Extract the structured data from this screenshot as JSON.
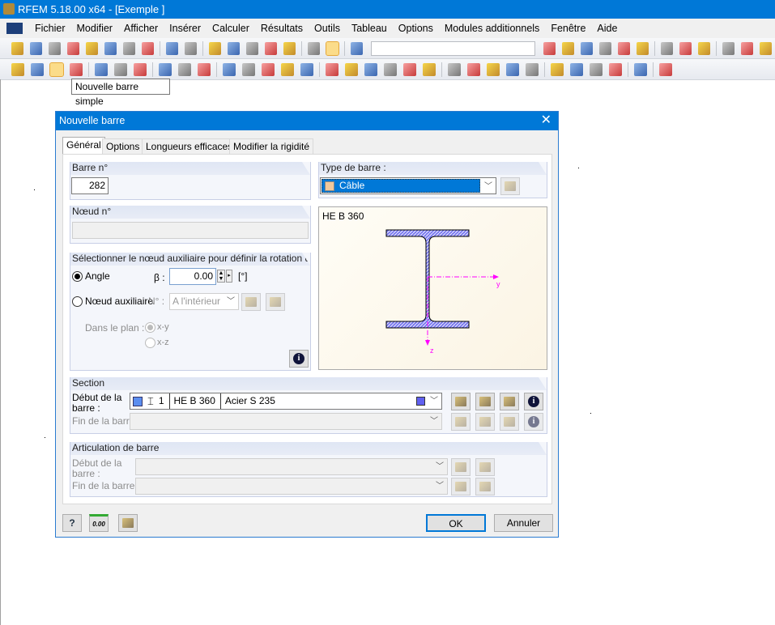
{
  "app": {
    "title": "RFEM 5.18.00 x64 - [Exemple ]"
  },
  "menu": [
    "Fichier",
    "Modifier",
    "Afficher",
    "Insérer",
    "Calculer",
    "Résultats",
    "Outils",
    "Tableau",
    "Options",
    "Modules additionnels",
    "Fenêtre",
    "Aide"
  ],
  "toolbar1": [
    "new-file-icon",
    "open-folder-icon",
    "archive-icon",
    "database-icon",
    "save-icon",
    "clipboard-icon",
    "print-icon",
    "print-preview-icon",
    "|",
    "undo-icon",
    "redo-icon",
    "|",
    "plane-icon",
    "lasso-icon",
    "target-icon",
    "select-add-icon",
    "window-icon",
    "|",
    "list-icon",
    "table-icon",
    "|",
    "node-load-icon",
    "COMBO",
    "prev-icon",
    "next-icon",
    "result-icon",
    "xxx-icon",
    "render-icon",
    "xxx2-icon",
    "|",
    "cursor-icon",
    "frame-icon",
    "grid-icon",
    "|",
    "grid2-icon",
    "zoom-icon",
    "pan-icon"
  ],
  "toolbar2": [
    "new-node-icon",
    "new-line-icon",
    "new-member-icon",
    "member-set-icon",
    "|",
    "support-icon",
    "hinge-icon",
    "surface-icon",
    "|",
    "dimension-icon",
    "label-icon",
    "guide-icon",
    "|",
    "load-case-icon",
    "frame-load-icon",
    "solid-load-icon",
    "box-icon",
    "copy-icon",
    "|",
    "move-icon",
    "arrow-icon",
    "mesh-icon",
    "mesh2-icon",
    "mesh3-icon",
    "mesh4-icon",
    "|",
    "view-icon",
    "zoom-window-icon",
    "zoom-out-icon",
    "iso-icon",
    "cube-icon",
    "|",
    "axis-x-icon",
    "axis-y-icon",
    "axis-z-icon",
    "axis-neg-x-icon",
    "|",
    "plot-icon",
    "|",
    "render-mode-icon"
  ],
  "tooltip": "Nouvelle barre simple",
  "dialog": {
    "title": "Nouvelle barre",
    "tabs": [
      "Général",
      "Options",
      "Longueurs efficaces",
      "Modifier la rigidité"
    ],
    "barre": {
      "label": "Barre n°",
      "value": "282"
    },
    "noeud": {
      "label": "Nœud n°",
      "value": ""
    },
    "rotation": {
      "label": "Sélectionner le nœud auxiliaire pour définir la rotation de barr",
      "angle_label": "Angle",
      "beta_label": "β :",
      "beta_value": "0.00",
      "unit": "[°]",
      "aux_label": "Nœud auxiliaire",
      "n_label": "N° :",
      "aux_value": "A l'intérieur",
      "plane_label": "Dans le plan :",
      "plane_xy": "x-y",
      "plane_xz": "x-z",
      "selected": "angle"
    },
    "type": {
      "label": "Type de barre :",
      "value": "Câble",
      "swatch": "#f0c89c"
    },
    "preview": {
      "section_name": "HE B 360",
      "axis_y": "y",
      "axis_z": "z",
      "fill": "#7b7bf0",
      "axis_color": "#ff00ff"
    },
    "section": {
      "label": "Section",
      "start_label": "Début de la barre :",
      "start_number": "1",
      "start_name": "HE B 360",
      "start_material": "Acier S 235",
      "end_label": "Fin de la barre :",
      "material_color": "#6060f0"
    },
    "hinge": {
      "label": "Articulation de barre",
      "start_label": "Début de la barre :",
      "end_label": "Fin de la barre :"
    },
    "buttons": {
      "ok": "OK",
      "cancel": "Annuler",
      "units": "0.00"
    }
  }
}
